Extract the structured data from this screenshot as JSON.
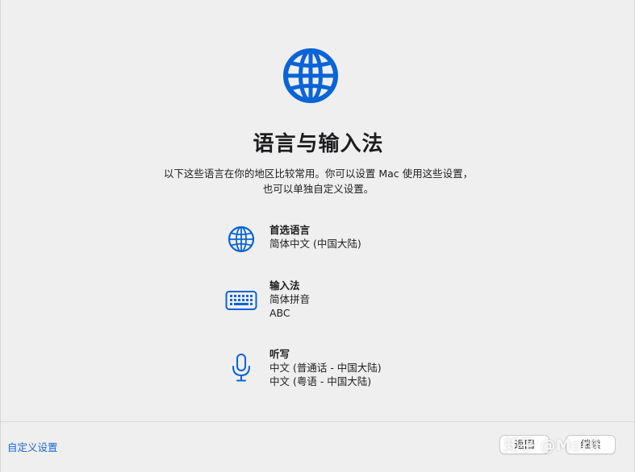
{
  "colors": {
    "accent": "#0a64d6",
    "link": "#1a66d2",
    "background": "#efefef"
  },
  "header": {
    "icon": "globe-icon",
    "title": "语言与输入法",
    "subtitle_line1": "以下这些语言在你的地区比较常用。你可以设置 Mac 使用这些设置，",
    "subtitle_line2": "也可以单独自定义设置。"
  },
  "sections": {
    "language": {
      "icon": "globe-icon",
      "title": "首选语言",
      "values": [
        "简体中文 (中国大陆)"
      ]
    },
    "input": {
      "icon": "keyboard-icon",
      "title": "输入法",
      "values": [
        "简体拼音",
        "ABC"
      ]
    },
    "dictation": {
      "icon": "microphone-icon",
      "title": "听写",
      "values": [
        "中文 (普通话 - 中国大陆)",
        "中文 (粤语 - 中国大陆)"
      ]
    }
  },
  "footer": {
    "customize_label": "自定义设置",
    "back_label": "返回",
    "continue_label": "继续"
  },
  "watermark": "知乎 @Morii"
}
